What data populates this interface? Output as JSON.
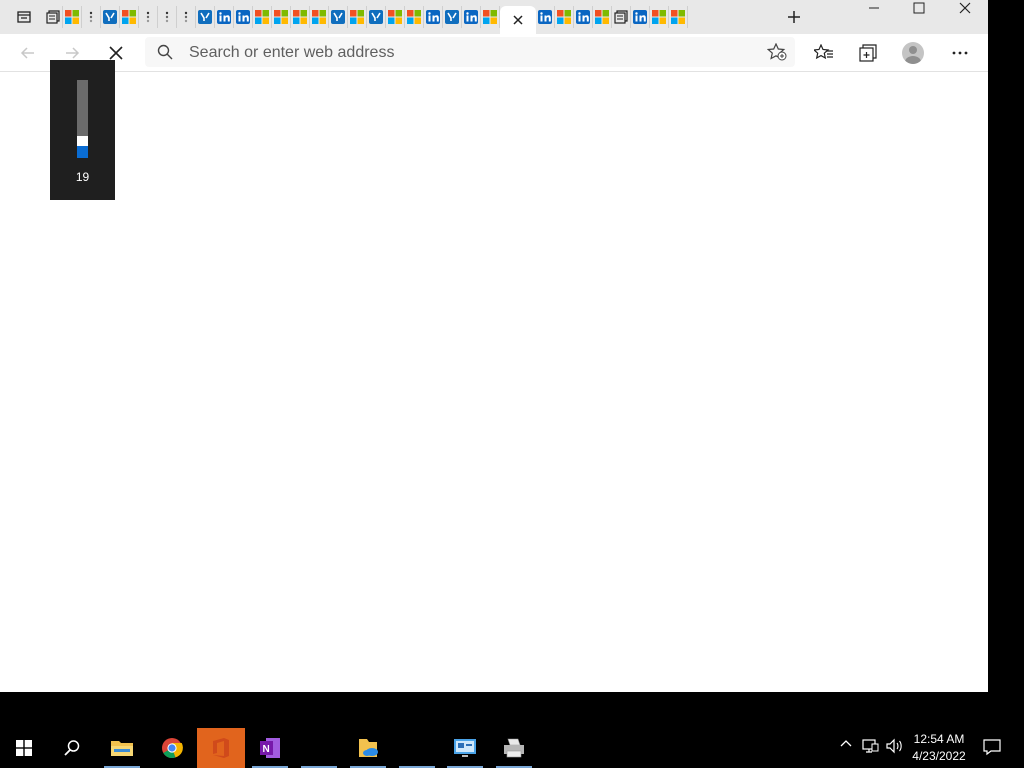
{
  "browser": {
    "tabs": [
      {
        "icon": "collections-icon"
      },
      {
        "icon": "microsoft-icon"
      },
      {
        "icon": "loading-icon"
      },
      {
        "icon": "yammer-icon"
      },
      {
        "icon": "microsoft-icon"
      },
      {
        "icon": "loading-icon"
      },
      {
        "icon": "loading-icon"
      },
      {
        "icon": "loading-icon"
      },
      {
        "icon": "yammer-icon"
      },
      {
        "icon": "linkedin-icon"
      },
      {
        "icon": "linkedin-icon"
      },
      {
        "icon": "microsoft-icon"
      },
      {
        "icon": "microsoft-icon"
      },
      {
        "icon": "microsoft-icon"
      },
      {
        "icon": "microsoft-icon"
      },
      {
        "icon": "yammer-icon"
      },
      {
        "icon": "microsoft-icon"
      },
      {
        "icon": "yammer-icon"
      },
      {
        "icon": "microsoft-icon"
      },
      {
        "icon": "microsoft-icon"
      },
      {
        "icon": "linkedin-icon"
      },
      {
        "icon": "yammer-icon"
      },
      {
        "icon": "linkedin-icon"
      },
      {
        "icon": "microsoft-icon"
      },
      {
        "icon": "active-close-icon"
      },
      {
        "icon": "linkedin-icon"
      },
      {
        "icon": "microsoft-icon"
      },
      {
        "icon": "linkedin-icon"
      },
      {
        "icon": "microsoft-icon"
      },
      {
        "icon": "collections-icon"
      },
      {
        "icon": "linkedin-icon"
      },
      {
        "icon": "microsoft-icon"
      },
      {
        "icon": "microsoft-icon"
      }
    ],
    "address": {
      "placeholder": "Search or enter web address",
      "value": ""
    }
  },
  "volume": {
    "level": 19,
    "label": "19"
  },
  "taskbar": {
    "clock": {
      "time": "12:54 AM",
      "date": "4/23/2022"
    },
    "apps": [
      "start-icon",
      "search-icon",
      "file-explorer-icon",
      "chrome-icon",
      "office-icon",
      "onenote-icon",
      "blank",
      "onedrive-folder-icon",
      "blank",
      "remote-desktop-icon",
      "printer-icon"
    ]
  },
  "colors": {
    "accent": "#0a6cd2",
    "office": "#d04a1b",
    "onenote": "#7719aa"
  }
}
